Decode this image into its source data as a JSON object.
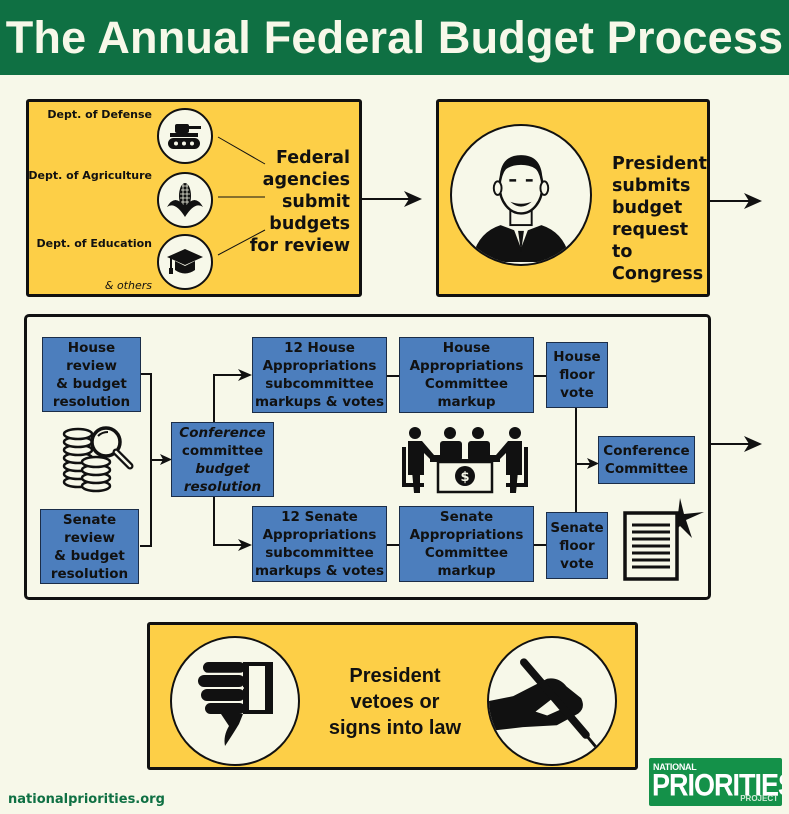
{
  "header": {
    "title": "The Annual Federal Budget Process"
  },
  "step1": {
    "departments": [
      {
        "label": "Dept. of Defense",
        "icon": "tank-icon"
      },
      {
        "label": "Dept. of Agriculture",
        "icon": "corn-icon"
      },
      {
        "label": "Dept. of Education",
        "icon": "graduation-cap-icon"
      }
    ],
    "others_label": "& others",
    "text_lines": [
      "Federal",
      "agencies",
      "submit",
      "budgets",
      "for review"
    ]
  },
  "step2": {
    "icon": "president-portrait-icon",
    "text_lines": [
      "President",
      "submits",
      "budget",
      "request to",
      "Congress"
    ]
  },
  "step3": {
    "house_review": [
      "House",
      "review",
      "& budget",
      "resolution"
    ],
    "senate_review": [
      "Senate",
      "review",
      "& budget",
      "resolution"
    ],
    "conference_budget": [
      "Conference",
      "committee",
      "budget",
      "resolution"
    ],
    "house_subcommittee": [
      "12 House",
      "Appropriations",
      "subcommittee",
      "markups & votes"
    ],
    "senate_subcommittee": [
      "12 Senate",
      "Appropriations",
      "subcommittee",
      "markups & votes"
    ],
    "house_committee": [
      "House",
      "Appropriations",
      "Committee",
      "markup"
    ],
    "senate_committee": [
      "Senate",
      "Appropriations",
      "Committee",
      "markup"
    ],
    "house_floor": [
      "House",
      "floor",
      "vote"
    ],
    "senate_floor": [
      "Senate",
      "floor",
      "vote"
    ],
    "conference_committee": [
      "Conference",
      "Committee"
    ],
    "icons": [
      "coins-magnifier-icon",
      "meeting-table-icon",
      "document-icon"
    ]
  },
  "step4": {
    "text_lines": [
      "President",
      "vetoes or",
      "signs into law"
    ],
    "icons": [
      "thumbs-down-icon",
      "signing-hand-icon"
    ]
  },
  "footer": {
    "url": "nationalpriorities.org",
    "logo": {
      "line1": "NATIONAL",
      "line2": "PRIORITIES",
      "line3": "PROJECT"
    }
  },
  "colors": {
    "header_green": "#0f7043",
    "background": "#f7f8e9",
    "yellow": "#fdcf47",
    "blue": "#4c7ebd"
  }
}
